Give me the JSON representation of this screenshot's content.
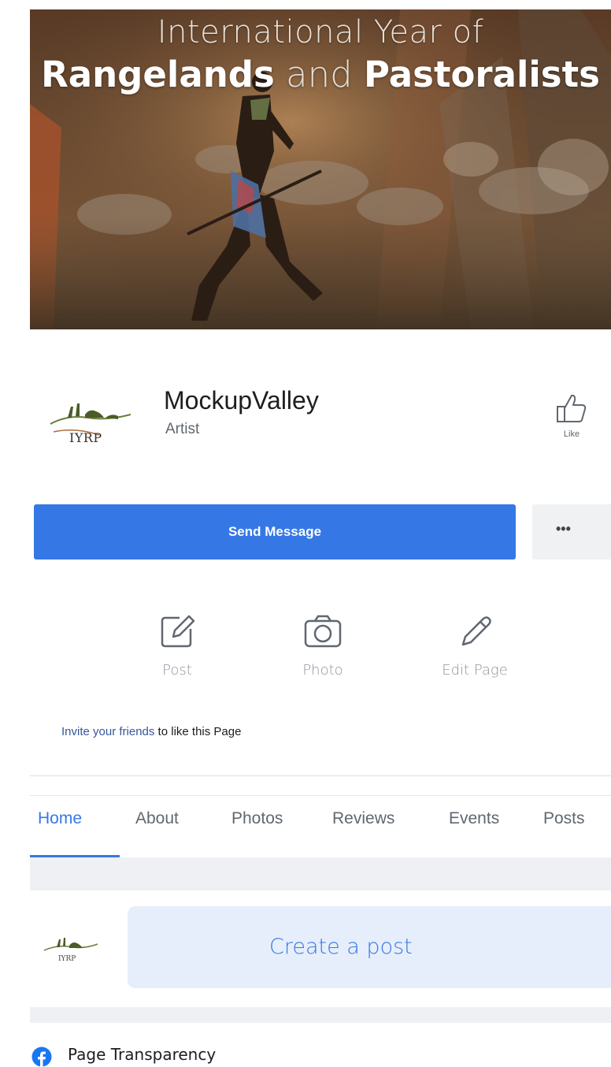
{
  "cover": {
    "line1": "International Year of",
    "line2_word1": "Rangelands",
    "line2_word2": "and",
    "line2_word3": "Pastoralists"
  },
  "profile": {
    "avatar_text": "IYRP",
    "name": "MockupValley",
    "category": "Artist",
    "like_label": "Like",
    "send_message_label": "Send Message",
    "more_label": "•••"
  },
  "actions": [
    {
      "label": "Post",
      "icon": "post-icon"
    },
    {
      "label": "Photo",
      "icon": "camera-icon"
    },
    {
      "label": "Edit Page",
      "icon": "pencil-icon"
    }
  ],
  "invite": {
    "link_text": "Invite your friends",
    "rest_text": " to like this Page"
  },
  "tabs": [
    {
      "label": "Home",
      "active": true
    },
    {
      "label": "About"
    },
    {
      "label": "Photos"
    },
    {
      "label": "Reviews"
    },
    {
      "label": "Events"
    },
    {
      "label": "Posts"
    }
  ],
  "composer": {
    "avatar_text": "IYRP",
    "placeholder": "Create a post"
  },
  "transparency": {
    "label": "Page Transparency",
    "icon": "facebook-icon"
  },
  "colors": {
    "accent": "#3578e5",
    "link": "#365899"
  }
}
